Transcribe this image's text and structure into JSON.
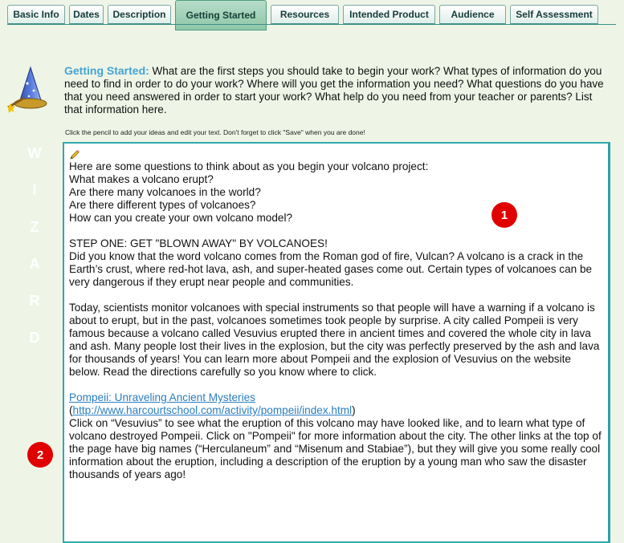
{
  "tabs": [
    {
      "label": "Basic Info",
      "width": 0
    },
    {
      "label": "Dates"
    },
    {
      "label": "Description"
    },
    {
      "label": "Getting Started",
      "active": true
    },
    {
      "label": "Resources"
    },
    {
      "label": "Intended Product"
    },
    {
      "label": "Audience"
    },
    {
      "label": "Self Assessment"
    }
  ],
  "wizard": {
    "letters": [
      "W",
      "I",
      "Z",
      "A",
      "R",
      "D"
    ]
  },
  "intro": {
    "heading": "Getting Started:",
    "text": " What are the first steps you should take to begin your work? What types of information do you need to find in order to do your work? Where will you get the information you need? What questions do you have that you need answered in order to start your work? What help do you need from your teacher or parents? List that information here.",
    "hint": "Click the pencil to add your ideas and edit your text. Don't forget to click \"Save\" when you are done!"
  },
  "editor": {
    "questions": [
      "Here are some questions to think about as you begin your volcano project:",
      "What makes a volcano erupt?",
      "Are there many volcanoes in the world?",
      "Are there different types of volcanoes?",
      "How can you create your own volcano model?"
    ],
    "step_title": "STEP ONE: GET \"BLOWN AWAY\" BY VOLCANOES!",
    "step_text": "Did you know that the word volcano comes from the Roman god of fire, Vulcan? A volcano is a crack in the Earth’s crust, where red-hot lava, ash, and super-heated gases come out. Certain types of volcanoes can be very dangerous if they erupt near people and communities.",
    "paragraph2": "Today, scientists monitor volcanoes with special instruments so that people will have a warning if a volcano is about to erupt, but in the past, volcanoes sometimes took people by surprise. A city called Pompeii is very famous because a volcano called Vesuvius erupted there in ancient times and covered the whole city in lava and ash. Many people lost their lives in the explosion, but the city was perfectly preserved by the ash and lava for thousands of years! You can learn more about Pompeii and the explosion of Vesuvius on the website below. Read the directions carefully so you know where to click.",
    "link_title": "Pompeii: Unraveling Ancient Mysteries",
    "link_url": "http://www.harcourtschool.com/activity/pompeii/index.html",
    "paragraph3": "Click on “Vesuvius” to see what the eruption of this volcano may have looked like, and to learn what type of volcano destroyed Pompeii. Click on \"Pompeii\" for more information about the city. The other links at the top of the page have big names (“Herculaneum” and “Misenum and Stabiae”), but they will give you some really cool information about the eruption, including a description of the eruption by a young man who saw the disaster thousands of years ago!"
  },
  "badges": [
    "1",
    "2"
  ],
  "colors": {
    "accent": "#44a3d6",
    "badge": "#e00000",
    "tab_active": "#8ec7a8",
    "border": "#31a8ae"
  }
}
